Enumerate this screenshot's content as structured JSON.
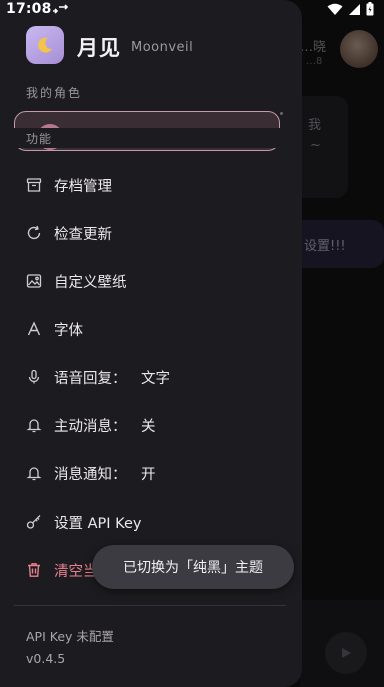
{
  "status_bar": {
    "time": "17:08"
  },
  "background_chat": {
    "header_name": "…晓",
    "header_sub": "…8",
    "bubble1_line1": "我",
    "bubble1_line2": "~",
    "bubble2_text": "设置!!!"
  },
  "drawer": {
    "app_name": "月见",
    "app_subtitle": "Moonveil",
    "section_my_roles": "我的角色",
    "section_functions": "功能",
    "menu": [
      {
        "label": "存档管理",
        "icon": "archive-icon"
      },
      {
        "label": "检查更新",
        "icon": "refresh-icon"
      },
      {
        "label": "自定义壁纸",
        "icon": "image-icon"
      },
      {
        "label": "字体",
        "icon": "font-icon"
      },
      {
        "label": "语音回复：",
        "value": "文字",
        "icon": "mic-icon"
      },
      {
        "label": "主动消息：",
        "value": "关",
        "icon": "bell-icon"
      },
      {
        "label": "消息通知：",
        "value": "开",
        "icon": "bell-icon"
      },
      {
        "label": "设置 API Key",
        "icon": "key-icon"
      },
      {
        "label": "清空当",
        "icon": "trash-icon"
      }
    ],
    "footer_api": "API Key 未配置",
    "footer_version": "v0.4.5"
  },
  "toast": {
    "text": "已切换为「纯黑」主题"
  },
  "colors": {
    "danger": "#e8828f",
    "accent": "#c9b8ef",
    "drawer_bg": "#1c1b1f"
  }
}
